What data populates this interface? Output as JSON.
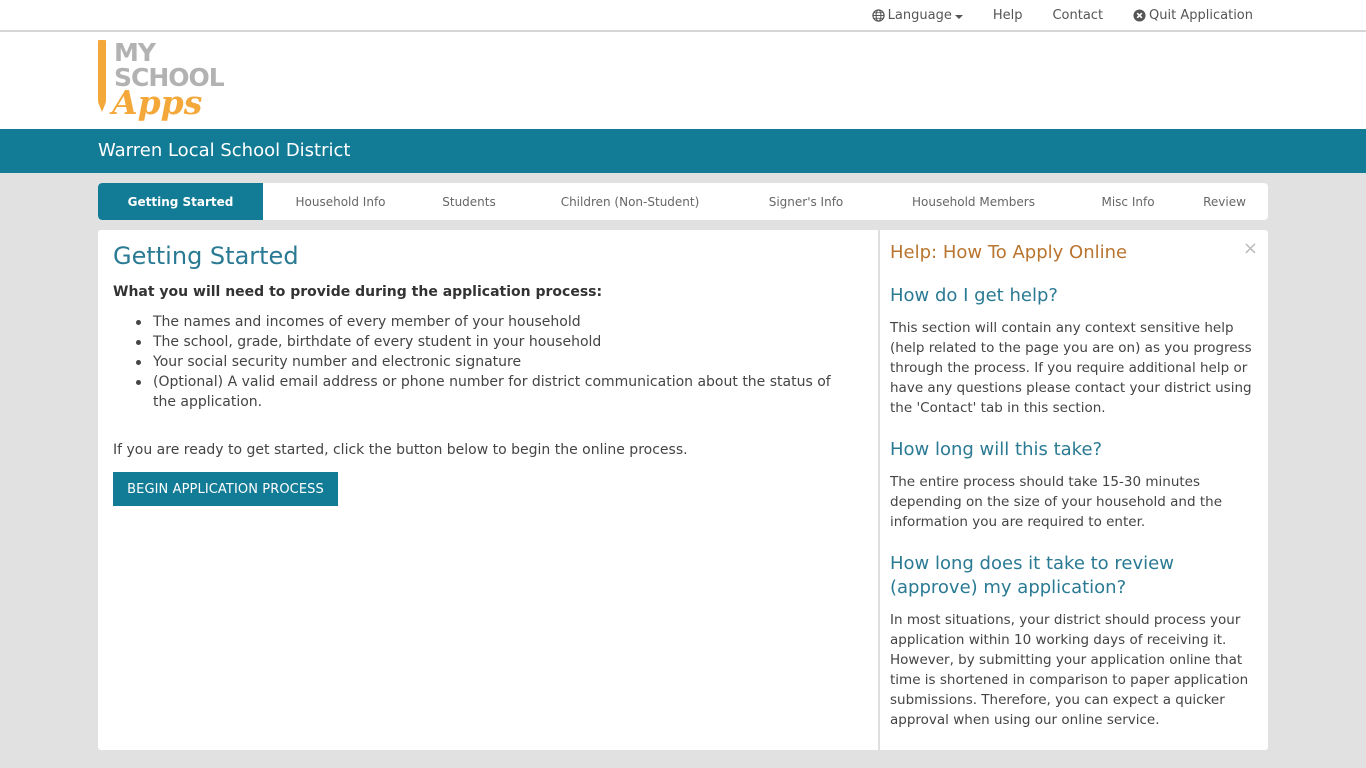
{
  "topnav": {
    "language": "Language",
    "help": "Help",
    "contact": "Contact",
    "quit": "Quit Application"
  },
  "logo": {
    "line1": "MY",
    "line2": "SCHOOL",
    "line3": "Apps"
  },
  "district": {
    "name": "Warren Local School District"
  },
  "tabs": [
    {
      "label": "Getting Started"
    },
    {
      "label": "Household Info"
    },
    {
      "label": "Students"
    },
    {
      "label": "Children (Non-Student)"
    },
    {
      "label": "Signer's Info"
    },
    {
      "label": "Household Members"
    },
    {
      "label": "Misc Info"
    },
    {
      "label": "Review"
    }
  ],
  "main": {
    "title": "Getting Started",
    "need_heading": "What you will need to provide during the application process:",
    "items": [
      "The names and incomes of every member of your household",
      "The school, grade, birthdate of every student in your household",
      "Your social security number and electronic signature",
      "(Optional) A valid email address or phone number for district communication about the status of the application."
    ],
    "ready_text": "If you are ready to get started, click the button below to begin the online process.",
    "begin_button": "BEGIN APPLICATION PROCESS"
  },
  "help": {
    "title": "Help: How To Apply Online",
    "close": "×",
    "sections": [
      {
        "question": "How do I get help?",
        "answer": "This section will contain any context sensitive help (help related to the page you are on) as you progress through the process. If you require additional help or have any questions please contact your district using the 'Contact' tab in this section."
      },
      {
        "question": "How long will this take?",
        "answer": "The entire process should take 15-30 minutes depending on the size of your household and the information you are required to enter."
      },
      {
        "question": "How long does it take to review (approve) my application?",
        "answer": "In most situations, your district should process your application within 10 working days of receiving it. However, by submitting your application online that time is shortened in comparison to paper application submissions. Therefore, you can expect a quicker approval when using our online service."
      }
    ]
  },
  "colors": {
    "accent": "#127b96",
    "logo_orange": "#f5a83a",
    "help_title": "#b9742f"
  }
}
